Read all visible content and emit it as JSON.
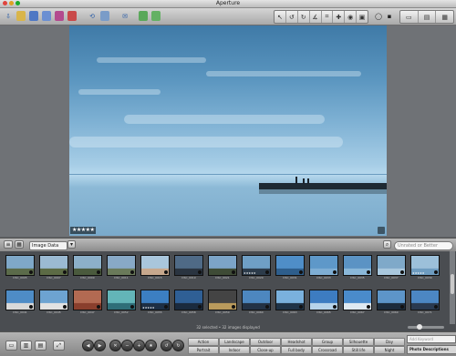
{
  "window": {
    "title": "Aperture"
  },
  "viewer": {
    "rating": "★★★★★"
  },
  "browser": {
    "metadata_view": "Image Data",
    "search_placeholder": "Unrated or Better",
    "status": "32 selected • 32 images displayed",
    "thumbs_row1": [
      {
        "caption": "DSC_0005",
        "stars": "",
        "colors": [
          "#7fa8c8",
          "#5b6b4a"
        ]
      },
      {
        "caption": "DSC_0007",
        "stars": "",
        "colors": [
          "#9bbad2",
          "#5c6b45"
        ]
      },
      {
        "caption": "DSC_0009",
        "stars": "",
        "colors": [
          "#8cb0c9",
          "#4a5a3d"
        ]
      },
      {
        "caption": "DSC_0011",
        "stars": "",
        "colors": [
          "#88a9c6",
          "#6a7a5a"
        ]
      },
      {
        "caption": "DSC_0015",
        "stars": "",
        "colors": [
          "#a9c6dc",
          "#c7a88d"
        ]
      },
      {
        "caption": "DSC_0019",
        "stars": "",
        "colors": [
          "#4f6a86",
          "#2a3440"
        ]
      },
      {
        "caption": "DSC_0021",
        "stars": "",
        "colors": [
          "#7ca4c7",
          "#3e4b36"
        ]
      },
      {
        "caption": "DSC_0029",
        "stars": "★★★★★",
        "colors": [
          "#6f9fc5",
          "#2c3b4a"
        ]
      },
      {
        "caption": "DSC_0031",
        "stars": "",
        "colors": [
          "#4f8ec8",
          "#2e5e8c"
        ]
      },
      {
        "caption": "DSC_0033",
        "stars": "",
        "colors": [
          "#5e98c9",
          "#7eaed4"
        ]
      },
      {
        "caption": "DSC_0035",
        "stars": "",
        "colors": [
          "#5b93c4",
          "#8ab8d9"
        ]
      },
      {
        "caption": "DSC_0037",
        "stars": "",
        "colors": [
          "#7fa9c9",
          "#a9c8de"
        ]
      },
      {
        "caption": "DSC_0039",
        "stars": "★★★★★",
        "colors": [
          "#9cc0da",
          "#6e9cc0"
        ]
      }
    ],
    "thumbs_row2": [
      {
        "caption": "DSC_0041",
        "stars": "",
        "colors": [
          "#4e8cc6",
          "#d9d9d9"
        ]
      },
      {
        "caption": "DSC_0045",
        "stars": "",
        "colors": [
          "#6da3d1",
          "#e2e2e2"
        ]
      },
      {
        "caption": "DSC_0047",
        "stars": "",
        "colors": [
          "#b26a52",
          "#8a3f2d"
        ]
      },
      {
        "caption": "DSC_0052",
        "stars": "",
        "colors": [
          "#63b5b8",
          "#2f6e78"
        ]
      },
      {
        "caption": "DSC_0055",
        "stars": "★★★★★",
        "colors": [
          "#3c7fc2",
          "#1d2f45"
        ]
      },
      {
        "caption": "DSC_0058",
        "stars": "",
        "colors": [
          "#2f5f95",
          "#1a2a3e"
        ]
      },
      {
        "caption": "DSC_0059",
        "stars": "",
        "colors": [
          "#444",
          "#b99a5c"
        ]
      },
      {
        "caption": "DSC_0060",
        "stars": "",
        "colors": [
          "#4d87bf",
          "#233245"
        ]
      },
      {
        "caption": "DSC_0063",
        "stars": "",
        "colors": [
          "#7ab1dd",
          "#1f3347"
        ]
      },
      {
        "caption": "DSC_0065",
        "stars": "",
        "colors": [
          "#3d7cc1",
          "#b7d3ea"
        ]
      },
      {
        "caption": "DSC_0067",
        "stars": "",
        "colors": [
          "#4a8bcb",
          "#dfe9f1"
        ]
      },
      {
        "caption": "DSC_0069",
        "stars": "",
        "colors": [
          "#5d95c8",
          "#1c2c3c"
        ]
      },
      {
        "caption": "DSC_0071",
        "stars": "",
        "colors": [
          "#4c87c3",
          "#2a3a50"
        ]
      }
    ]
  },
  "keywords": {
    "row1": [
      "Action",
      "Landscape",
      "Outdoor",
      "Headshot",
      "Group",
      "Silhouette",
      "Day"
    ],
    "row2": [
      "Portrait",
      "Indoor",
      "Close-up",
      "Full body",
      "Crossroad",
      "Still life",
      "Night"
    ],
    "add_placeholder": "Add Keyword",
    "preset_group": "Photo Descriptions"
  }
}
